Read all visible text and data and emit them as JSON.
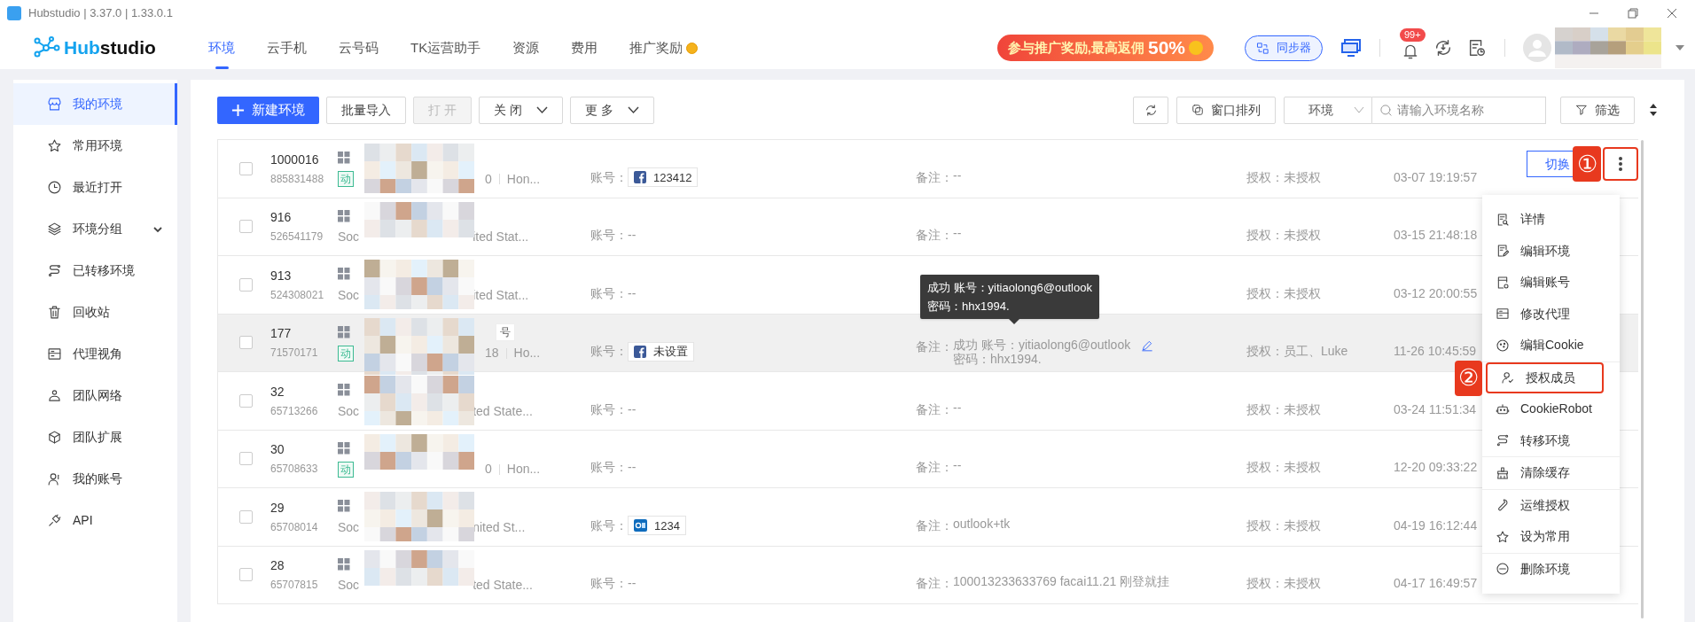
{
  "window": {
    "title": "Hubstudio | 3.37.0 | 1.33.0.1"
  },
  "logo": {
    "prefix": "Hub",
    "suffix": "studio"
  },
  "nav_tabs": [
    {
      "label": "环境",
      "selected": true,
      "coin": false
    },
    {
      "label": "云手机",
      "selected": false,
      "coin": false
    },
    {
      "label": "云号码",
      "selected": false,
      "coin": false
    },
    {
      "label": "TK运营助手",
      "selected": false,
      "coin": false
    },
    {
      "label": "资源",
      "selected": false,
      "coin": false
    },
    {
      "label": "费用",
      "selected": false,
      "coin": false
    },
    {
      "label": "推广奖励",
      "selected": false,
      "coin": true
    }
  ],
  "promo": {
    "text": "参与推广奖励,最高返佣",
    "highlight": "50%"
  },
  "sync_button": "同步器",
  "notifications": {
    "count": "99+"
  },
  "sidebar": {
    "items": [
      {
        "label": "我的环境",
        "selected": true,
        "expandable": false
      },
      {
        "label": "常用环境",
        "selected": false,
        "expandable": false
      },
      {
        "label": "最近打开",
        "selected": false,
        "expandable": false
      },
      {
        "label": "环境分组",
        "selected": false,
        "expandable": true
      },
      {
        "label": "已转移环境",
        "selected": false,
        "expandable": false
      },
      {
        "label": "回收站",
        "selected": false,
        "expandable": false
      },
      {
        "label": "代理视角",
        "selected": false,
        "expandable": false
      },
      {
        "label": "团队网络",
        "selected": false,
        "expandable": false
      },
      {
        "label": "团队扩展",
        "selected": false,
        "expandable": false
      },
      {
        "label": "我的账号",
        "selected": false,
        "expandable": false
      },
      {
        "label": "API",
        "selected": false,
        "expandable": false
      }
    ]
  },
  "toolbar": {
    "primary": "新建环境",
    "buttons": [
      {
        "label": "批量导入",
        "disabled": false,
        "dropdown": false
      },
      {
        "label": "打 开",
        "disabled": true,
        "dropdown": false
      },
      {
        "label": "关 闭",
        "disabled": false,
        "dropdown": true
      },
      {
        "label": "更 多",
        "disabled": false,
        "dropdown": true
      }
    ],
    "arrange": "窗口排列",
    "env_select": "环境",
    "search_placeholder": "请输入环境名称",
    "filter": "筛选"
  },
  "rows": [
    {
      "id": "1000016",
      "code": "885831488",
      "kind": "dynamic",
      "tag": "动",
      "region": "0",
      "city": "Hon...",
      "account_label": "账号：",
      "account": {
        "kind": "facebook",
        "value": "123412"
      },
      "note_label": "备注：",
      "note": [
        "--"
      ],
      "auth_label": "授权：",
      "auth": "未授权",
      "date": "03-07 19:19:57",
      "highlighted": false,
      "edit": false,
      "action": {
        "label": "切换",
        "annotation": "①"
      }
    },
    {
      "id": "916",
      "code": "526541179",
      "kind": "social",
      "prefix": "Soc",
      "region": "ited Stat...",
      "account_label": "账号：",
      "account_empty": "--",
      "note_label": "备注：",
      "note": [
        "--"
      ],
      "auth_label": "授权：",
      "auth": "未授权",
      "date": "03-15 21:48:18",
      "highlighted": false,
      "edit": false
    },
    {
      "id": "913",
      "code": "524308021",
      "kind": "social",
      "prefix": "Soc",
      "region": "ited Stat...",
      "account_label": "账号：",
      "account_empty": "--",
      "auth_label": "授权：",
      "auth": "未授权",
      "date": "03-12 20:00:55",
      "highlighted": false
    },
    {
      "id": "177",
      "code": "71570171",
      "kind": "dynamic",
      "tag": "动",
      "extra": "号",
      "region": "18",
      "city": "Ho...",
      "account_label": "账号：",
      "account": {
        "kind": "facebook",
        "value": "未设置"
      },
      "note_label": "备注：",
      "note": [
        "成功 账号：yitiaolong6@outlook",
        "密码：hhx1994."
      ],
      "auth_label": "授权：",
      "auth": "员工、Luke",
      "date": "11-26 10:45:59",
      "highlighted": true,
      "edit": true
    },
    {
      "id": "32",
      "code": "65713266",
      "kind": "social",
      "prefix": "Soc",
      "region": "ted State...",
      "account_label": "账号：",
      "account_empty": "--",
      "note_label": "备注：",
      "note": [
        "--"
      ],
      "auth_label": "授权：",
      "auth": "未授权",
      "date": "03-24 11:51:34",
      "highlighted": false,
      "edit": false
    },
    {
      "id": "30",
      "code": "65708633",
      "kind": "dynamic",
      "tag": "动",
      "region": "0",
      "city": "Hon...",
      "account_label": "账号：",
      "account_empty": "--",
      "note_label": "备注：",
      "note": [
        "--"
      ],
      "auth_label": "授权：",
      "auth": "未授权",
      "date": "12-20 09:33:22",
      "highlighted": false,
      "edit": false
    },
    {
      "id": "29",
      "code": "65708014",
      "kind": "social",
      "prefix": "Soc",
      "region": "nited St...",
      "account_label": "账号：",
      "account": {
        "kind": "outlook",
        "value": "1234"
      },
      "note_label": "备注：",
      "note": [
        "outlook+tk"
      ],
      "auth_label": "授权：",
      "auth": "未授权",
      "date": "04-19 16:12:44",
      "highlighted": false,
      "edit": false
    },
    {
      "id": "28",
      "code": "65707815",
      "kind": "social",
      "prefix": "Soc",
      "region": "ted State...",
      "account_label": "账号：",
      "account_empty": "--",
      "note_label": "备注：",
      "note": [
        "100013233633769 facai11.21 刚登就挂"
      ],
      "auth_label": "授权：",
      "auth": "未授权",
      "date": "04-17 16:49:57",
      "highlighted": false,
      "edit": false
    }
  ],
  "tooltip": [
    "成功 账号：yitiaolong6@outlook",
    "密码：hhx1994."
  ],
  "menu": {
    "sections": [
      [
        {
          "label": "详情"
        },
        {
          "label": "编辑环境"
        },
        {
          "label": "编辑账号"
        },
        {
          "label": "修改代理"
        },
        {
          "label": "编辑Cookie"
        }
      ],
      [
        {
          "label": "授权成员",
          "annotation": "②"
        },
        {
          "label": "CookieRobot"
        },
        {
          "label": "转移环境"
        }
      ],
      [
        {
          "label": "清除缓存"
        }
      ],
      [
        {
          "label": "运维授权"
        },
        {
          "label": "设为常用"
        }
      ],
      [
        {
          "label": "删除环境"
        }
      ]
    ]
  }
}
